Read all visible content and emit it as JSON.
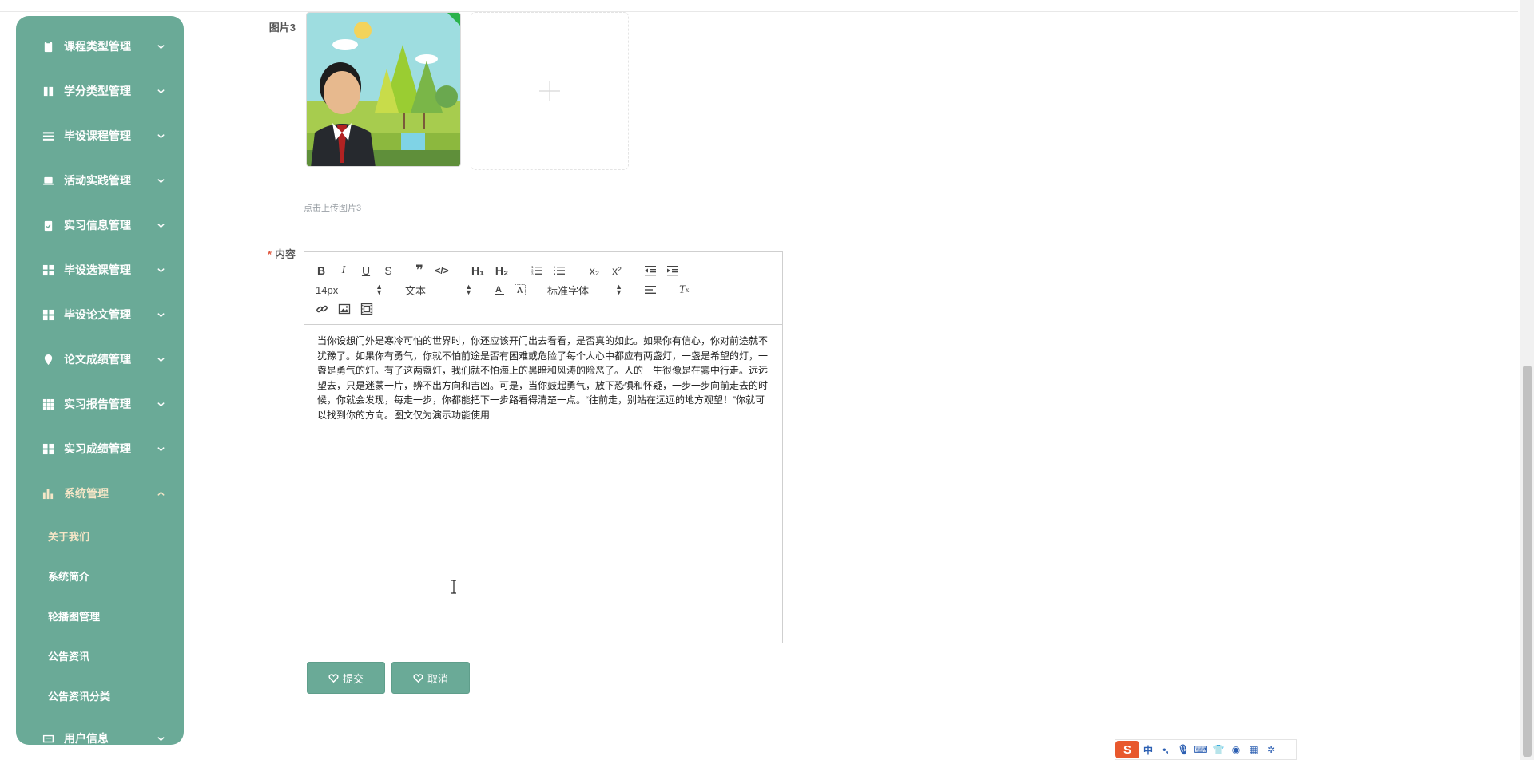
{
  "sidebar": {
    "items": [
      {
        "label": "课程类型管理",
        "icon": "clipboard-icon"
      },
      {
        "label": "学分类型管理",
        "icon": "book-icon"
      },
      {
        "label": "毕设课程管理",
        "icon": "list-icon"
      },
      {
        "label": "活动实践管理",
        "icon": "laptop-icon"
      },
      {
        "label": "实习信息管理",
        "icon": "clipboard-check-icon"
      },
      {
        "label": "毕设选课管理",
        "icon": "grid-icon"
      },
      {
        "label": "毕设论文管理",
        "icon": "grid-icon"
      },
      {
        "label": "论文成绩管理",
        "icon": "location-icon"
      },
      {
        "label": "实习报告管理",
        "icon": "table-icon"
      },
      {
        "label": "实习成绩管理",
        "icon": "grid-icon"
      },
      {
        "label": "系统管理",
        "icon": "bar-chart-icon"
      },
      {
        "label": "用户信息",
        "icon": "id-card-icon"
      }
    ],
    "sub_items": [
      "关于我们",
      "系统简介",
      "轮播图管理",
      "公告资讯",
      "公告资讯分类"
    ]
  },
  "form": {
    "image_label": "图片3",
    "image_tip": "点击上传图片3",
    "content_label": "内容",
    "required_mark": "*"
  },
  "editor": {
    "font_size": "14px",
    "block_format": "文本",
    "font_family": "标准字体",
    "content": "当你设想门外是寒冷可怕的世界时，你还应该开门出去看看，是否真的如此。如果你有信心，你对前途就不犹豫了。如果你有勇气，你就不怕前途是否有困难或危险了每个人心中都应有两盏灯，一盏是希望的灯，一盏是勇气的灯。有了这两盏灯，我们就不怕海上的黑暗和风涛的险恶了。人的一生很像是在雾中行走。远远望去，只是迷蒙一片，辨不出方向和吉凶。可是，当你鼓起勇气，放下恐惧和怀疑，一步一步向前走去的时候，你就会发现，每走一步，你都能把下一步路看得清楚一点。“往前走，别站在远远的地方观望！”你就可以找到你的方向。图文仅为演示功能使用"
  },
  "buttons": {
    "submit": "提交",
    "cancel": "取消"
  },
  "ime": {
    "lang": "中",
    "punct": "•,"
  },
  "colors": {
    "sidebar_bg": "#6aaa97",
    "active_text": "#f6e6c7",
    "button_bg": "#6aaa97"
  }
}
